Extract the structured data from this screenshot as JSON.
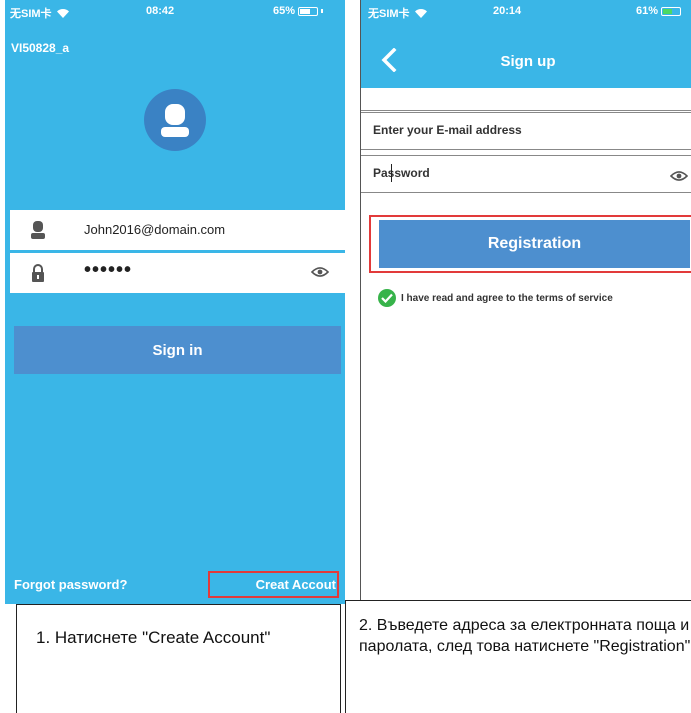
{
  "phone1": {
    "status": {
      "carrier": "无SIM卡",
      "time": "08:42",
      "battery": "65%",
      "battery_level": 0.65
    },
    "device_name": "VI50828_a",
    "email_value": "John2016@domain.com",
    "password_value": "••••••",
    "signin_label": "Sign in",
    "forgot_label": "Forgot password?",
    "create_label": "Creat Accout"
  },
  "phone2": {
    "status": {
      "carrier": "无SIM卡",
      "time": "20:14",
      "battery": "61%",
      "battery_level": 0.61
    },
    "title": "Sign up",
    "email_placeholder": "Enter your E-mail address",
    "password_placeholder": "Password",
    "registration_label": "Registration",
    "agree_text": "I have read and agree to the terms of service"
  },
  "captions": {
    "step1": "1. Натиснете \"Create Account\"",
    "step2": "2. Въведете адреса за електронната поща и паролата, след това натиснете \"Registration\"."
  },
  "colors": {
    "app_blue": "#3ab6e7",
    "button_blue": "#4d8fcf",
    "avatar_blue": "#3a82c4",
    "highlight_red": "#e23a3a",
    "check_green": "#37b34a",
    "battery_green": "#4cd964"
  },
  "icons": [
    "wifi-icon",
    "battery-icon",
    "avatar-icon",
    "user-icon",
    "lock-icon",
    "eye-icon",
    "back-arrow-icon",
    "checkmark-icon"
  ]
}
